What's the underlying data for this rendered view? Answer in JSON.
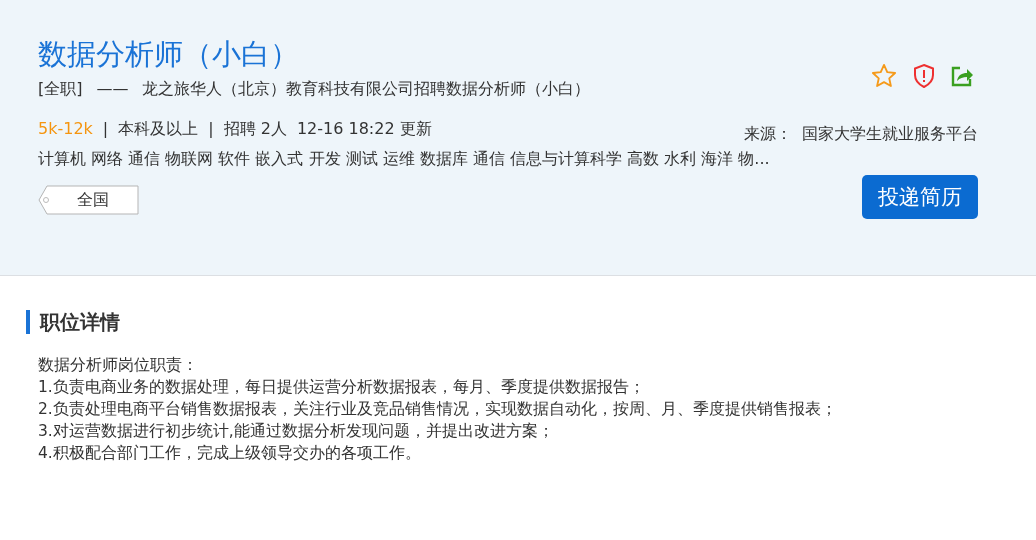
{
  "job": {
    "title": "数据分析师（小白）",
    "type": "[全职]",
    "dash": "——",
    "company": "龙之旅华人（北京）教育科技有限公司招聘数据分析师（小白）",
    "salary": "5k-12k",
    "separator": "|",
    "education": "本科及以上",
    "headcount": "招聘 2人",
    "updated": "12-16 18:22 更新",
    "keywords": "计算机 网络 通信 物联网 软件 嵌入式 开发 测试 运维 数据库 通信 信息与计算科学 高数 水利 海洋 物...",
    "location": "全国",
    "source_label": "来源：",
    "source": "国家大学生就业服务平台",
    "apply_button": "投递简历"
  },
  "details": {
    "heading": "职位详情",
    "lines": [
      "数据分析师岗位职责：",
      "1.负责电商业务的数据处理，每日提供运营分析数据报表，每月、季度提供数据报告；",
      "2.负责处理电商平台销售数据报表，关注行业及竞品销售情况，实现数据自动化，按周、月、季度提供销售报表；",
      "3.对运营数据进行初步统计,能通过数据分析发现问题，并提出改进方案；",
      "4.积极配合部门工作，完成上级领导交办的各项工作。"
    ]
  }
}
